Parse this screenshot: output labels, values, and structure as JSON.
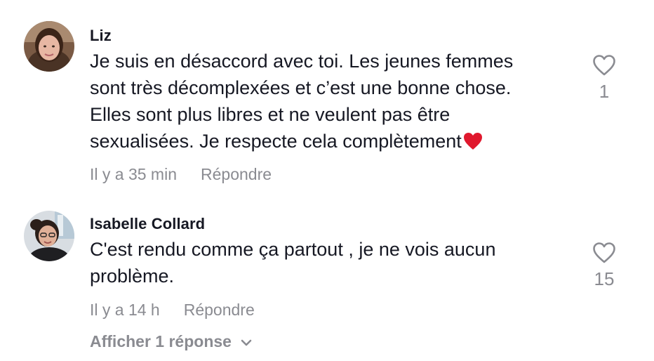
{
  "comments": [
    {
      "username": "Liz",
      "text_lines": [
        "Je suis en désaccord avec toi. Les jeunes femmes",
        "sont très décomplexées et c’est une bonne chose.",
        "Elles sont plus libres et ne veulent pas être",
        "sexualisées. Je respecte cela complètement"
      ],
      "emoji": "red-heart-emoji",
      "time": "Il y a 35 min",
      "reply_label": "Répondre",
      "like_count": "1"
    },
    {
      "username": "Isabelle Collard",
      "text_lines": [
        "C'est rendu comme ça partout , je ne vois aucun",
        "problème."
      ],
      "time": "Il y a 14 h",
      "reply_label": "Répondre",
      "like_count": "15",
      "view_replies_label": "Afficher 1 réponse"
    }
  ],
  "icons": {
    "like": "heart-outline-icon",
    "expand": "chevron-down-icon"
  },
  "colors": {
    "text": "#161823",
    "muted": "#8a8b91",
    "heart_emoji": "#e0182d"
  }
}
